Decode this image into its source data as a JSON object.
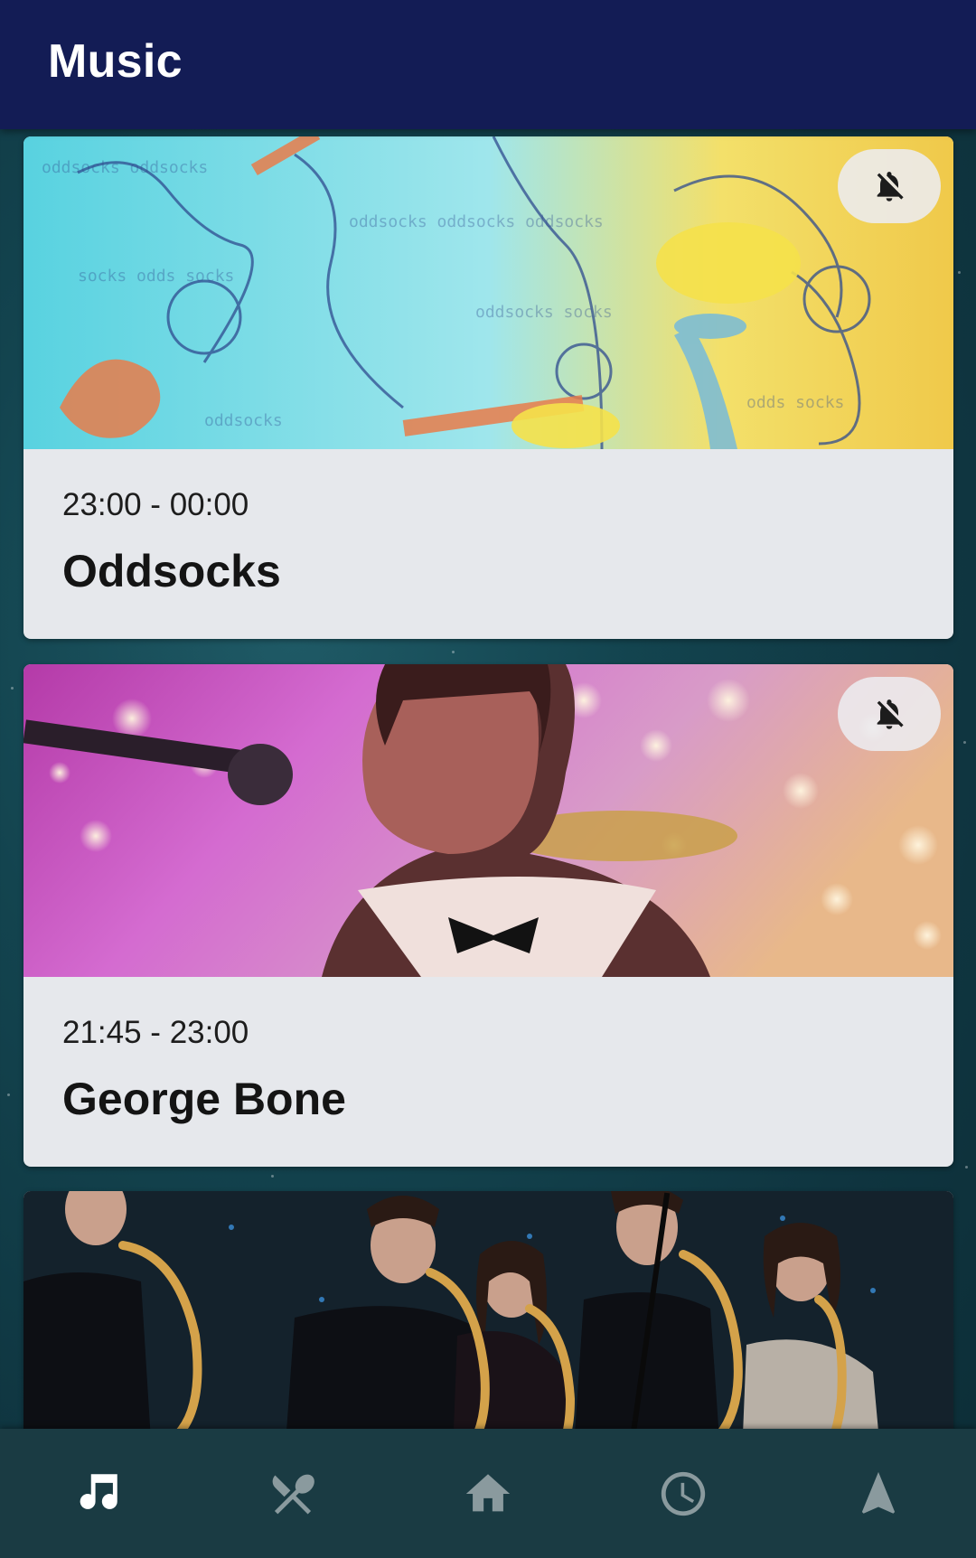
{
  "app_bar": {
    "title": "Music"
  },
  "events": [
    {
      "time": "23:00 - 00:00",
      "name": "Oddsocks",
      "image_icon": "band-illustration-image",
      "bell_icon": "bell-off-icon"
    },
    {
      "time": "21:45 - 23:00",
      "name": "George Bone",
      "image_icon": "singer-photo-image",
      "bell_icon": "bell-off-icon"
    },
    {
      "image_icon": "saxophone-section-photo-image"
    }
  ],
  "bottom_nav": {
    "items": [
      {
        "icon": "music-note-icon",
        "active": true
      },
      {
        "icon": "fork-knife-icon",
        "active": false
      },
      {
        "icon": "home-icon",
        "active": false
      },
      {
        "icon": "clock-icon",
        "active": false
      },
      {
        "icon": "navigation-arrow-icon",
        "active": false
      }
    ]
  },
  "colors": {
    "app_bar": "#131c55",
    "nav_bar": "#1a3b43",
    "card_bg": "#e6e8ec",
    "nav_active": "#ffffff",
    "nav_inactive": "#8a9a9e"
  }
}
